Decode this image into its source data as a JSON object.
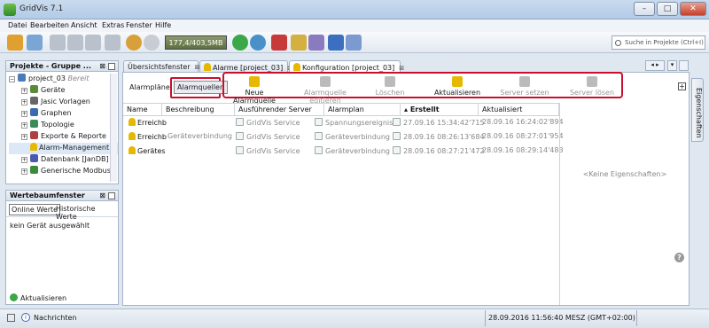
{
  "window": {
    "title": "GridVis 7.1",
    "min": "–",
    "max": "□",
    "close": "✕"
  },
  "menu": [
    "Datei",
    "Bearbeiten",
    "Ansicht",
    "Extras",
    "Fenster",
    "Hilfe"
  ],
  "toolbar": {
    "memory": "177,4/403,5MB",
    "search_placeholder": "Suche in Projekte (Ctrl+I)"
  },
  "projects_panel": {
    "title": "Projekte - Gruppe ...",
    "root": "project_03",
    "root_status": "Bereit",
    "items": [
      "Geräte",
      "Jasic Vorlagen",
      "Graphen",
      "Topologie",
      "Exporte & Reporte",
      "Alarm-Management",
      "Datenbank [JanDB]",
      "Generische Modbus"
    ]
  },
  "werte_panel": {
    "title": "Wertebaumfenster",
    "tab_online": "Online Werte",
    "tab_hist": "Historische Werte",
    "status": "kein Gerät ausgewählt",
    "refresh": "Aktualisieren"
  },
  "tabs": [
    {
      "label": "Übersichtsfenster"
    },
    {
      "label": "Alarme [project_03]"
    },
    {
      "label": "Konfiguration [project_03]"
    }
  ],
  "subtabs": {
    "plans": "Alarmpläne",
    "sources": "Alarmquellen"
  },
  "actions": {
    "new": "Neue Alarmquelle",
    "edit": "Alarmquelle editieren",
    "delete": "Löschen",
    "refresh": "Aktualisieren",
    "set_server": "Server setzen",
    "release_server": "Server lösen"
  },
  "table": {
    "headers": [
      "Name",
      "Beschreibung",
      "Ausführender Server",
      "Alarmplan",
      "Erstellt",
      "Aktualisiert"
    ],
    "rows": [
      {
        "name": "Erreichb",
        "desc": "",
        "server": "GridVis Service",
        "plan": "Spannungsereignis",
        "created": "27.09.16 15:34:42'715",
        "updated": "28.09.16 16:24:02'894"
      },
      {
        "name": "Erreichb",
        "desc": "Geräteverbindung",
        "server": "GridVis Service",
        "plan": "Geräteverbindung",
        "created": "28.09.16 08:26:13'684",
        "updated": "28.09.16 08:27:01'954"
      },
      {
        "name": "Gerätes",
        "desc": "",
        "server": "GridVis Service",
        "plan": "Geräteverbindung",
        "created": "28.09.16 08:27:21'472",
        "updated": "28.09.16 08:29:14'483"
      }
    ]
  },
  "properties": {
    "empty": "<Keine Eigenschaften>",
    "side_tab": "Eigenschaften",
    "help": "?"
  },
  "statusbar": {
    "messages": "Nachrichten",
    "datetime": "28.09.2016 11:56:40 MESZ (GMT+02:00)"
  },
  "colors": {
    "highlight": "#c8102e",
    "accent": "#4a78b5"
  }
}
